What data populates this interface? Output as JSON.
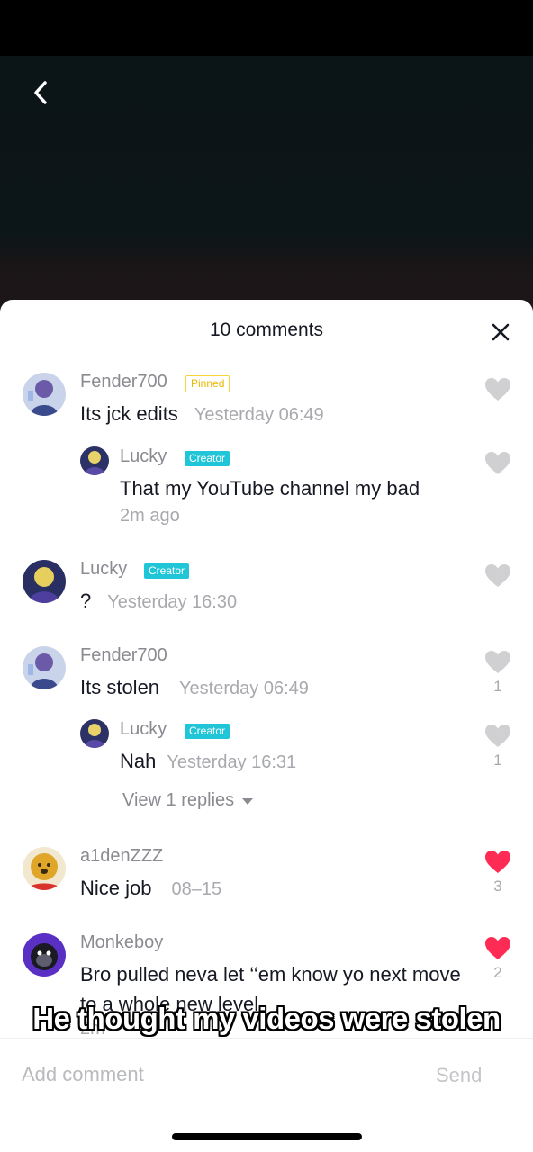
{
  "sheet": {
    "title": "10 comments"
  },
  "comments": [
    {
      "username": "Fender700",
      "badge": "Pinned",
      "text": "Its jck edits",
      "time": "Yesterday 06:49",
      "likes": "",
      "liked": false
    },
    {
      "username": "Lucky",
      "badge": "Creator",
      "text": "That my YouTube channel my bad",
      "time": "2m ago",
      "likes": "",
      "liked": false
    },
    {
      "username": "Lucky",
      "badge": "Creator",
      "text": "?",
      "time": "Yesterday 16:30",
      "likes": "",
      "liked": false
    },
    {
      "username": "Fender700",
      "badge": "",
      "text": "Its stolen",
      "time": "Yesterday 06:49",
      "likes": "1",
      "liked": false
    },
    {
      "username": "Lucky",
      "badge": "Creator",
      "text": "Nah",
      "time": "Yesterday 16:31",
      "likes": "1",
      "liked": false
    },
    {
      "username": "a1denZZZ",
      "badge": "",
      "text": "Nice job",
      "time": "08–15",
      "likes": "3",
      "liked": true
    },
    {
      "username": "Monkeboy",
      "badge": "",
      "text": "Bro pulled neva let ‘‘em know yo next move to a whole new level",
      "time": "2m",
      "likes": "2",
      "liked": true
    }
  ],
  "view_replies": "View 1 replies",
  "caption": "He thought my videos were stolen",
  "input": {
    "placeholder": "Add comment",
    "send_label": "Send"
  },
  "colors": {
    "liked": "#fe2c55",
    "unliked": "#d0d0d3",
    "creator_badge": "#20c6d7",
    "pinned_badge": "#f5d33c"
  }
}
